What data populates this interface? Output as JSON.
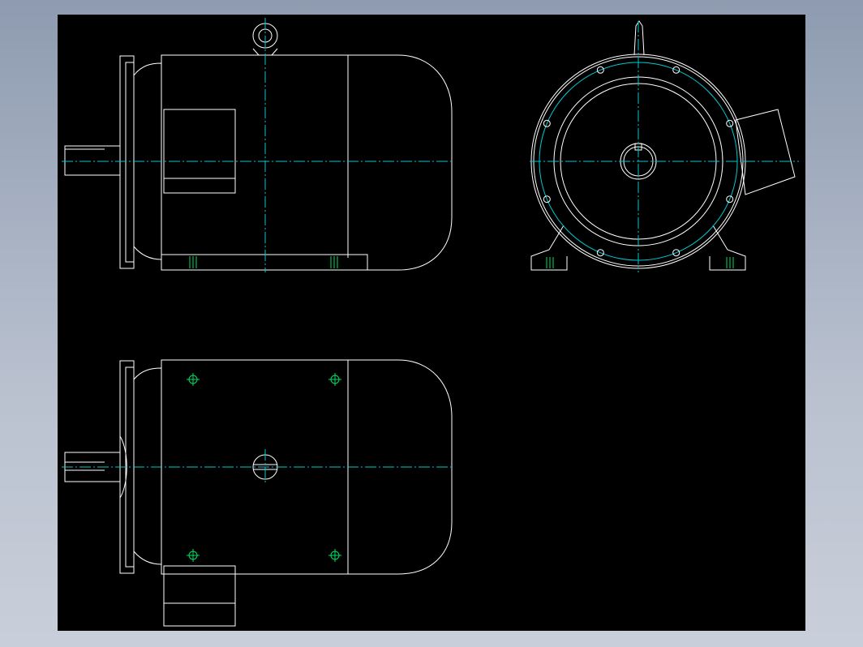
{
  "colors": {
    "background": "#000000",
    "outline": "#ffffff",
    "centerline": "#00c8d2",
    "hole_marker": "#00e060",
    "window_gradient_top": "#8e9bb0",
    "window_gradient_bottom": "#c9cfda"
  },
  "views": [
    {
      "name": "side-elevation-view"
    },
    {
      "name": "end-view"
    },
    {
      "name": "top-plan-view"
    }
  ]
}
